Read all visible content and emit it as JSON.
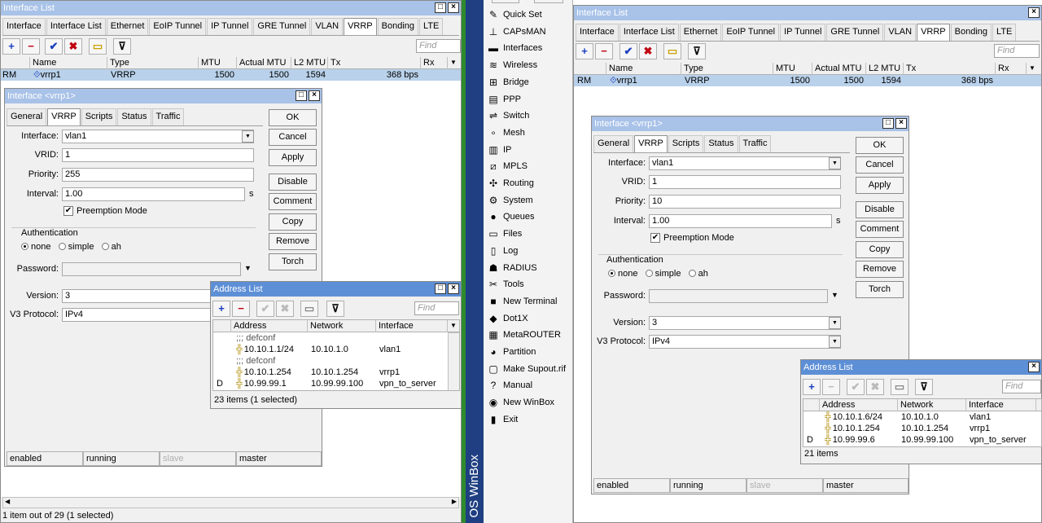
{
  "left": {
    "iface_list": {
      "title": "Interface List",
      "tabs": [
        "Interface",
        "Interface List",
        "Ethernet",
        "EoIP Tunnel",
        "IP Tunnel",
        "GRE Tunnel",
        "VLAN",
        "VRRP",
        "Bonding",
        "LTE"
      ],
      "selected_tab": "VRRP",
      "find_placeholder": "Find",
      "columns": [
        "",
        "Name",
        "Type",
        "MTU",
        "Actual MTU",
        "L2 MTU",
        "Tx",
        "Rx"
      ],
      "row": {
        "flags": "RM",
        "name": "vrrp1",
        "type": "VRRP",
        "mtu": "1500",
        "actual_mtu": "1500",
        "l2_mtu": "1594",
        "tx": "368 bps"
      },
      "footer": "1 item out of 29 (1 selected)"
    },
    "vrrp_dialog": {
      "title": "Interface <vrrp1>",
      "tabs": [
        "General",
        "VRRP",
        "Scripts",
        "Status",
        "Traffic"
      ],
      "selected_tab": "VRRP",
      "interface_label": "Interface:",
      "interface": "vlan1",
      "vrid_label": "VRID:",
      "vrid": "1",
      "priority_label": "Priority:",
      "priority": "255",
      "interval_label": "Interval:",
      "interval": "1.00",
      "interval_unit": "s",
      "preemption_label": "Preemption Mode",
      "auth_label": "Authentication",
      "auth_none": "none",
      "auth_simple": "simple",
      "auth_ah": "ah",
      "password_label": "Password:",
      "version_label": "Version:",
      "version": "3",
      "v3_label": "V3 Protocol:",
      "v3": "IPv4",
      "buttons": [
        "OK",
        "Cancel",
        "Apply",
        "Disable",
        "Comment",
        "Copy",
        "Remove",
        "Torch"
      ],
      "status": [
        "enabled",
        "running",
        "slave",
        "master"
      ]
    },
    "addr_list": {
      "title": "Address List",
      "find_placeholder": "Find",
      "columns": [
        "Address",
        "Network",
        "Interface"
      ],
      "rows": [
        {
          "type": "comment",
          "text": ";;; defconf"
        },
        {
          "flag": "",
          "address": "10.10.1.1/24",
          "network": "10.10.1.0",
          "iface": "vlan1"
        },
        {
          "type": "comment",
          "text": ";;; defconf"
        },
        {
          "flag": "",
          "address": "10.10.1.254",
          "network": "10.10.1.254",
          "iface": "vrrp1"
        },
        {
          "flag": "D",
          "address": "10.99.99.1",
          "network": "10.99.99.100",
          "iface": "vpn_to_server"
        }
      ],
      "footer": "23 items (1 selected)"
    }
  },
  "menu": {
    "items": [
      {
        "label": "Quick Set",
        "icon": "quick-set-icon",
        "glyph": "✎",
        "sub": false
      },
      {
        "label": "CAPsMAN",
        "icon": "capsman-icon",
        "glyph": "⊥",
        "sub": false
      },
      {
        "label": "Interfaces",
        "icon": "interfaces-icon",
        "glyph": "▬",
        "sub": false
      },
      {
        "label": "Wireless",
        "icon": "wireless-icon",
        "glyph": "≋",
        "sub": false
      },
      {
        "label": "Bridge",
        "icon": "bridge-icon",
        "glyph": "⊞",
        "sub": false
      },
      {
        "label": "PPP",
        "icon": "ppp-icon",
        "glyph": "▤",
        "sub": false
      },
      {
        "label": "Switch",
        "icon": "switch-icon",
        "glyph": "⇌",
        "sub": false
      },
      {
        "label": "Mesh",
        "icon": "mesh-icon",
        "glyph": "∘",
        "sub": false
      },
      {
        "label": "IP",
        "icon": "ip-icon",
        "glyph": "▥",
        "sub": true
      },
      {
        "label": "MPLS",
        "icon": "mpls-icon",
        "glyph": "⧄",
        "sub": true
      },
      {
        "label": "Routing",
        "icon": "routing-icon",
        "glyph": "✣",
        "sub": true
      },
      {
        "label": "System",
        "icon": "system-icon",
        "glyph": "⚙",
        "sub": true
      },
      {
        "label": "Queues",
        "icon": "queues-icon",
        "glyph": "●",
        "sub": false
      },
      {
        "label": "Files",
        "icon": "files-icon",
        "glyph": "▭",
        "sub": false
      },
      {
        "label": "Log",
        "icon": "log-icon",
        "glyph": "▯",
        "sub": false
      },
      {
        "label": "RADIUS",
        "icon": "radius-icon",
        "glyph": "☗",
        "sub": false
      },
      {
        "label": "Tools",
        "icon": "tools-icon",
        "glyph": "✂",
        "sub": true
      },
      {
        "label": "New Terminal",
        "icon": "terminal-icon",
        "glyph": "■",
        "sub": false
      },
      {
        "label": "Dot1X",
        "icon": "dot1x-icon",
        "glyph": "◆",
        "sub": false
      },
      {
        "label": "MetaROUTER",
        "icon": "metarouter-icon",
        "glyph": "▦",
        "sub": false
      },
      {
        "label": "Partition",
        "icon": "partition-icon",
        "glyph": "◕",
        "sub": false
      },
      {
        "label": "Make Supout.rif",
        "icon": "supout-icon",
        "glyph": "▢",
        "sub": false
      },
      {
        "label": "Manual",
        "icon": "manual-icon",
        "glyph": "?",
        "sub": false
      },
      {
        "label": "New WinBox",
        "icon": "winbox-icon",
        "glyph": "◉",
        "sub": false
      },
      {
        "label": "Exit",
        "icon": "exit-icon",
        "glyph": "▮",
        "sub": false
      }
    ],
    "brand": "OS WinBox"
  },
  "right": {
    "iface_list": {
      "title": "Interface List",
      "tabs": [
        "Interface",
        "Interface List",
        "Ethernet",
        "EoIP Tunnel",
        "IP Tunnel",
        "GRE Tunnel",
        "VLAN",
        "VRRP",
        "Bonding",
        "LTE"
      ],
      "selected_tab": "VRRP",
      "find_placeholder": "Find",
      "columns": [
        "",
        "Name",
        "Type",
        "MTU",
        "Actual MTU",
        "L2 MTU",
        "Tx",
        "Rx"
      ],
      "row": {
        "flags": "RM",
        "name": "vrrp1",
        "type": "VRRP",
        "mtu": "1500",
        "actual_mtu": "1500",
        "l2_mtu": "1594",
        "tx": "368 bps"
      }
    },
    "vrrp_dialog": {
      "title": "Interface <vrrp1>",
      "tabs": [
        "General",
        "VRRP",
        "Scripts",
        "Status",
        "Traffic"
      ],
      "selected_tab": "VRRP",
      "interface_label": "Interface:",
      "interface": "vlan1",
      "vrid_label": "VRID:",
      "vrid": "1",
      "priority_label": "Priority:",
      "priority": "10",
      "interval_label": "Interval:",
      "interval": "1.00",
      "interval_unit": "s",
      "preemption_label": "Preemption Mode",
      "auth_label": "Authentication",
      "auth_none": "none",
      "auth_simple": "simple",
      "auth_ah": "ah",
      "password_label": "Password:",
      "version_label": "Version:",
      "version": "3",
      "v3_label": "V3 Protocol:",
      "v3": "IPv4",
      "buttons": [
        "OK",
        "Cancel",
        "Apply",
        "Disable",
        "Comment",
        "Copy",
        "Remove",
        "Torch"
      ],
      "status": [
        "enabled",
        "running",
        "slave",
        "master"
      ]
    },
    "addr_list": {
      "title": "Address List",
      "find_placeholder": "Find",
      "columns": [
        "Address",
        "Network",
        "Interface"
      ],
      "rows": [
        {
          "flag": "",
          "address": "10.10.1.6/24",
          "network": "10.10.1.0",
          "iface": "vlan1"
        },
        {
          "flag": "",
          "address": "10.10.1.254",
          "network": "10.10.1.254",
          "iface": "vrrp1"
        },
        {
          "flag": "D",
          "address": "10.99.99.6",
          "network": "10.99.99.100",
          "iface": "vpn_to_server"
        }
      ],
      "footer": "21 items"
    }
  },
  "colors": {
    "title_active": "#5d8fd6",
    "title_inactive": "#a8c2e8",
    "selected_row": "#b9d1ea",
    "sidebar": "#1f3f82",
    "divider": "#2e8b2e"
  }
}
